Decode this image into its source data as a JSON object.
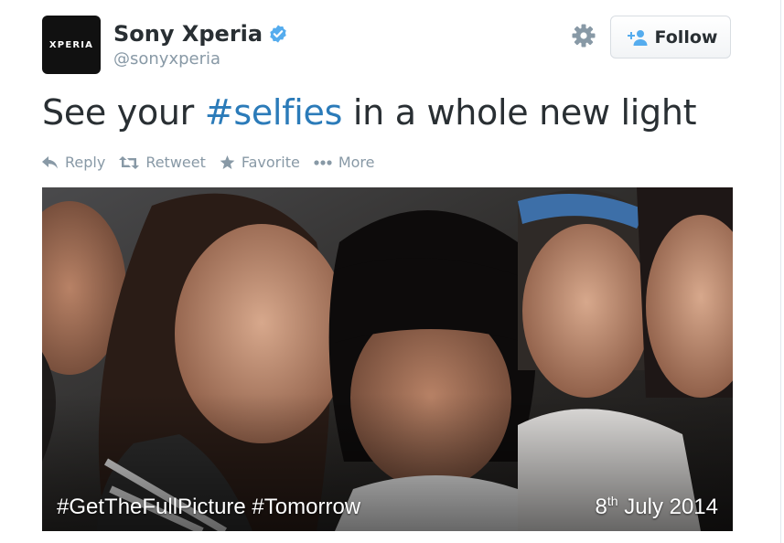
{
  "account": {
    "avatar_text": "XPERIA",
    "name": "Sony Xperia",
    "handle": "@sonyxperia",
    "verified": true
  },
  "follow_button": {
    "label": "Follow",
    "icon": "add-user-icon"
  },
  "settings_icon": "gear-icon",
  "tweet": {
    "text_before": "See your ",
    "hashtag": "#selfies",
    "text_after": " in a whole new light"
  },
  "actions": [
    {
      "label": "Reply",
      "icon": "reply-icon"
    },
    {
      "label": "Retweet",
      "icon": "retweet-icon"
    },
    {
      "label": "Favorite",
      "icon": "star-icon"
    },
    {
      "label": "More",
      "icon": "more-dots-icon"
    }
  ],
  "photo": {
    "caption_left": "#GetTheFullPicture #Tomorrow",
    "caption_right_day": "8",
    "caption_right_suffix": "th",
    "caption_right_rest": " July 2014"
  },
  "colors": {
    "link": "#2b7bb9",
    "muted": "#8899a6",
    "text": "#292f33",
    "verified": "#55acee"
  }
}
